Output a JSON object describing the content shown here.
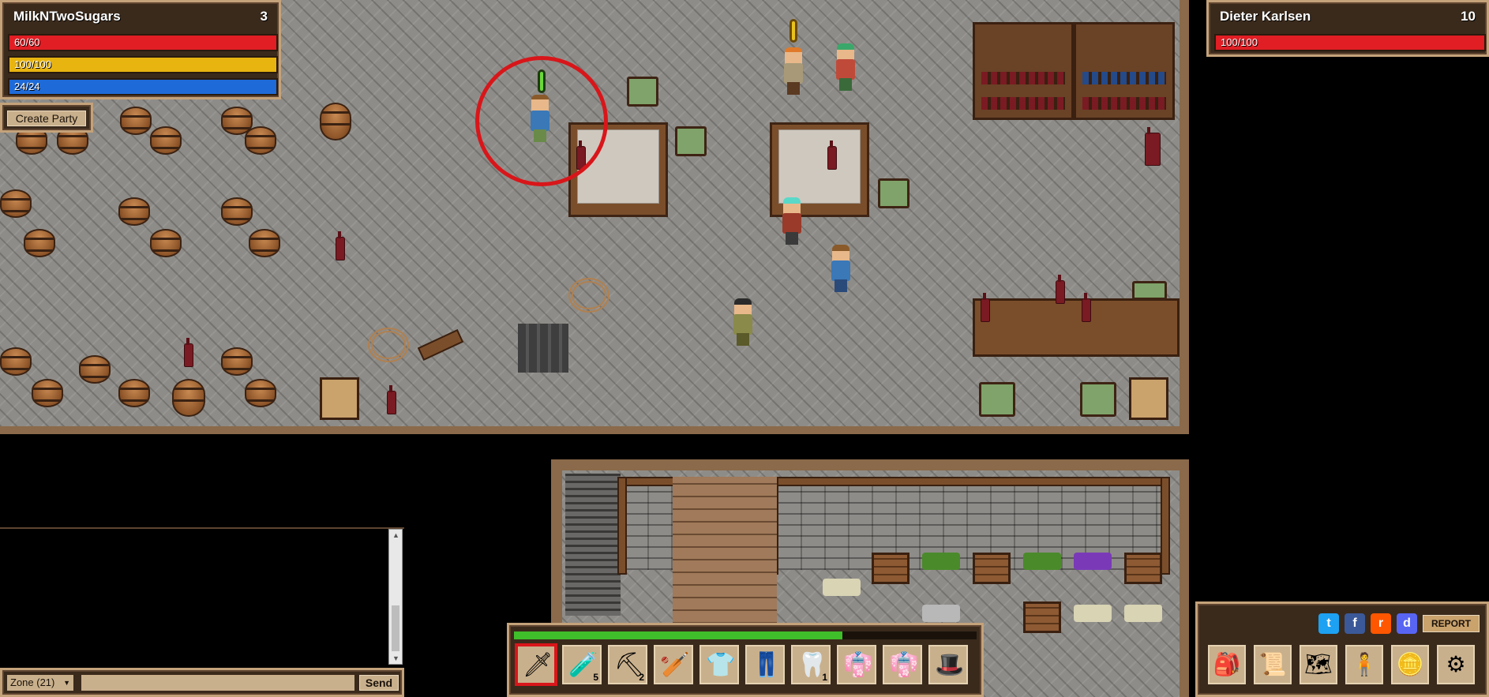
{
  "player": {
    "name": "MilkNTwoSugars",
    "level": "3",
    "health": {
      "text": "60/60",
      "fraction": 1.0,
      "color": "#e01e24"
    },
    "energy": {
      "text": "100/100",
      "fraction": 1.0,
      "color": "#e8b410"
    },
    "mana": {
      "text": "24/24",
      "fraction": 1.0,
      "color": "#1e6ad8"
    },
    "create_party_label": "Create Party"
  },
  "target": {
    "name": "Dieter Karlsen",
    "level": "10",
    "health": {
      "text": "100/100",
      "fraction": 1.0,
      "color": "#e01e24"
    }
  },
  "chat": {
    "channel": "Zone (21)",
    "input_placeholder": "",
    "send_label": "Send"
  },
  "hotbar": {
    "xp_fraction": 0.71,
    "xp_color": "#3fbf2a",
    "slots": [
      {
        "icon": "sword-icon",
        "qty": ""
      },
      {
        "icon": "potion-icon",
        "qty": "5"
      },
      {
        "icon": "pickaxe-icon",
        "qty": "2"
      },
      {
        "icon": "club-icon",
        "qty": ""
      },
      {
        "icon": "shirt-blue-icon",
        "qty": ""
      },
      {
        "icon": "pants-icon",
        "qty": ""
      },
      {
        "icon": "tooth-icon",
        "qty": "1"
      },
      {
        "icon": "tunic-icon",
        "qty": ""
      },
      {
        "icon": "tunic-icon",
        "qty": ""
      },
      {
        "icon": "hat-icon",
        "qty": ""
      }
    ]
  },
  "menu": {
    "report_label": "REPORT",
    "social": [
      "twitter-icon",
      "facebook-icon",
      "reddit-icon",
      "discord-icon"
    ],
    "buttons": [
      "inventory-bag-icon",
      "quest-scroll-icon",
      "world-map-icon",
      "character-icon",
      "gold-coins-icon",
      "settings-gear-icon"
    ]
  }
}
